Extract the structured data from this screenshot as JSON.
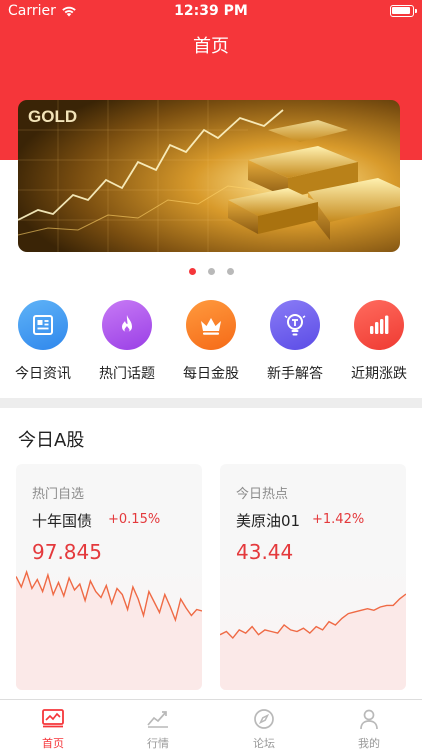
{
  "status_bar": {
    "carrier": "Carrier",
    "time": "12:39 PM"
  },
  "header": {
    "title": "首页"
  },
  "banner": {
    "text": "GOLD",
    "slides": 3,
    "active_slide": 0
  },
  "quick_menu": [
    {
      "label": "今日资讯",
      "icon": "newspaper-icon",
      "color_from": "#5fb3f7",
      "color_to": "#2f87ec"
    },
    {
      "label": "热门话题",
      "icon": "flame-icon",
      "color_from": "#c77af5",
      "color_to": "#9a3fe6"
    },
    {
      "label": "每日金股",
      "icon": "crown-icon",
      "color_from": "#ff9a3e",
      "color_to": "#f56a17"
    },
    {
      "label": "新手解答",
      "icon": "lightbulb-icon",
      "color_from": "#8a7cf6",
      "color_to": "#5b4ce6"
    },
    {
      "label": "近期涨跌",
      "icon": "bar-chart-icon",
      "color_from": "#ff6b5e",
      "color_to": "#ef3a32"
    }
  ],
  "section": {
    "title": "今日A股"
  },
  "cards": [
    {
      "category": "热门自选",
      "name": "十年国债",
      "change": "+0.15%",
      "price": "97.845",
      "spark": [
        62,
        55,
        65,
        54,
        60,
        52,
        63,
        50,
        58,
        49,
        61,
        53,
        57,
        46,
        59,
        52,
        48,
        56,
        44,
        54,
        50,
        40,
        55,
        47,
        36,
        52,
        45,
        38,
        50,
        42,
        33,
        47,
        41,
        36,
        40,
        39
      ]
    },
    {
      "category": "今日热点",
      "name": "美原油01",
      "change": "+1.42%",
      "price": "43.44",
      "spark": [
        30,
        32,
        28,
        33,
        31,
        35,
        30,
        33,
        32,
        31,
        36,
        33,
        32,
        34,
        31,
        35,
        33,
        38,
        36,
        40,
        43,
        44,
        45,
        46,
        45,
        47,
        48,
        48,
        52,
        55
      ]
    }
  ],
  "tabbar": [
    {
      "label": "首页",
      "icon": "home-chart-icon",
      "active": true
    },
    {
      "label": "行情",
      "icon": "trend-chart-icon",
      "active": false
    },
    {
      "label": "论坛",
      "icon": "compass-icon",
      "active": false
    },
    {
      "label": "我的",
      "icon": "profile-icon",
      "active": false
    }
  ],
  "colors": {
    "brand": "#f5363a",
    "rise": "#e4393c",
    "muted": "#999999"
  }
}
